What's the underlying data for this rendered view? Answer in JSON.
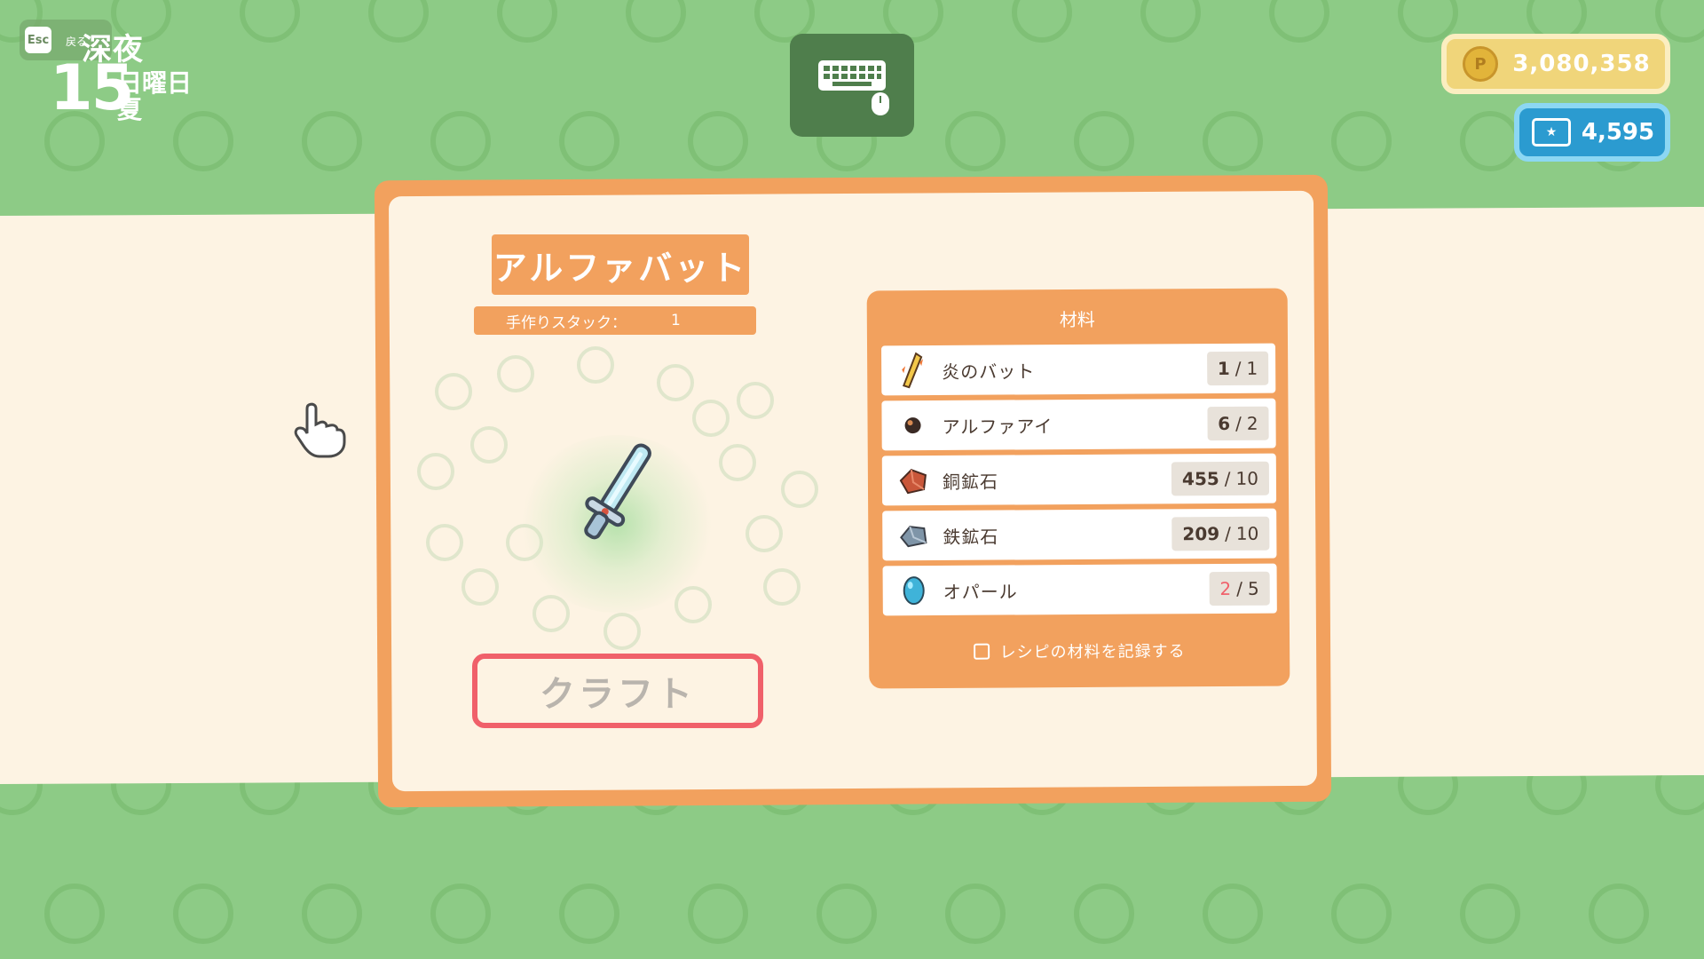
{
  "hud": {
    "esc_key": "Esc",
    "esc_label": "戻る",
    "time_of_day": "深夜",
    "day_number": "15",
    "weekday": "日曜日",
    "season": "夏"
  },
  "input_indicator": {
    "icon": "keyboard-mouse-icon"
  },
  "currency": {
    "coins": "3,080,358",
    "coin_icon_symbol": "P",
    "tickets": "4,595"
  },
  "recipe": {
    "title": "アルファバット",
    "stack_label": "手作りスタック：",
    "stack_value": "1",
    "craft_label": "クラフト"
  },
  "materials": {
    "title": "材料",
    "items": [
      {
        "name": "炎のバット",
        "have": "1",
        "need": "1",
        "icon": "fire-bat-icon",
        "short": false
      },
      {
        "name": "アルファアイ",
        "have": "6",
        "need": "2",
        "icon": "alpha-eye-icon",
        "short": false
      },
      {
        "name": "銅鉱石",
        "have": "455",
        "need": "10",
        "icon": "copper-ore-icon",
        "short": false
      },
      {
        "name": "鉄鉱石",
        "have": "209",
        "need": "10",
        "icon": "iron-ore-icon",
        "short": false
      },
      {
        "name": "オパール",
        "have": "2",
        "need": "5",
        "icon": "opal-icon",
        "short": true
      }
    ],
    "record_label": "レシピの材料を記録する",
    "separator": "/"
  }
}
